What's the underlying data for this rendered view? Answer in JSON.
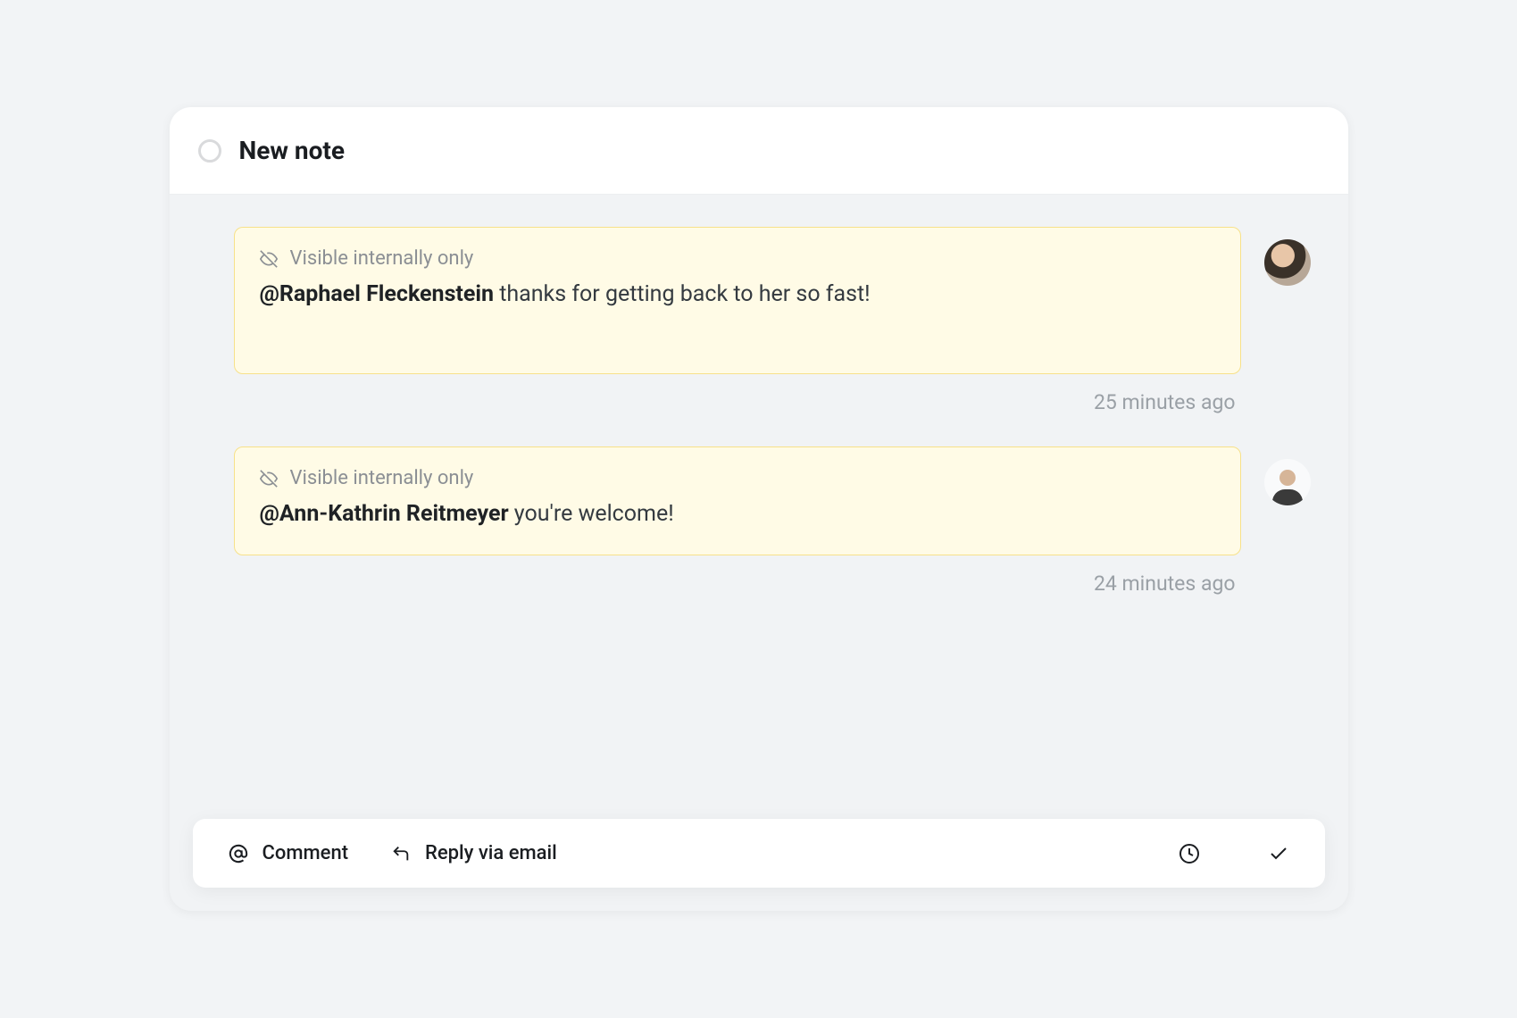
{
  "header": {
    "title": "New note"
  },
  "notes": [
    {
      "visibility_label": "Visible internally only",
      "mention": "@Raphael Fleckenstein",
      "message": " thanks for getting back to her so fast!",
      "timestamp": "25 minutes ago"
    },
    {
      "visibility_label": "Visible internally only",
      "mention": "@Ann-Kathrin Reitmeyer",
      "message": " you're welcome!",
      "timestamp": "24 minutes ago"
    }
  ],
  "composer": {
    "comment_label": "Comment",
    "reply_email_label": "Reply via email"
  }
}
